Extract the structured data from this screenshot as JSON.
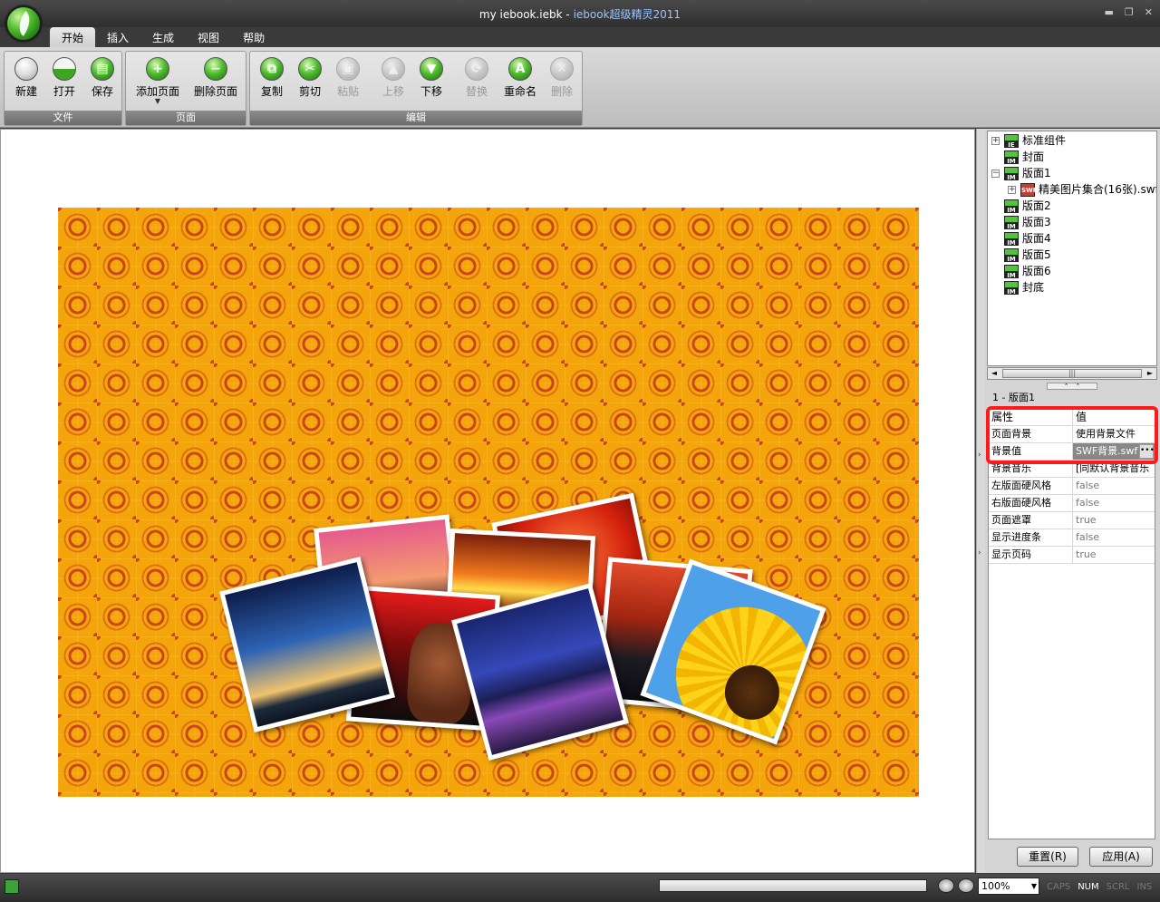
{
  "window": {
    "title_file": "my iebook.iebk - ",
    "title_app": "iebook超级精灵2011"
  },
  "tabs": [
    "开始",
    "插入",
    "生成",
    "视图",
    "帮助"
  ],
  "ribbon": {
    "file_group": {
      "label": "文件",
      "new": "新建",
      "open": "打开",
      "save": "保存"
    },
    "page_group": {
      "label": "页面",
      "add": "添加页面",
      "delete": "删除页面"
    },
    "edit_group": {
      "label": "编辑",
      "copy": "复制",
      "cut": "剪切",
      "paste": "粘贴",
      "up": "上移",
      "down": "下移",
      "replace": "替换",
      "rename": "重命名",
      "remove": "删除"
    }
  },
  "tree": {
    "items": [
      "标准组件",
      "封面",
      "版面1",
      "精美图片集合(16张).swf",
      "版面2",
      "版面3",
      "版面4",
      "版面5",
      "版面6",
      "封底"
    ]
  },
  "panel": {
    "caption": "1 - 版面1",
    "reset": "重置(R)",
    "apply": "应用(A)"
  },
  "props": {
    "head_key": "属性",
    "head_val": "值",
    "rows": [
      {
        "k": "页面背景",
        "v": "使用背景文件"
      },
      {
        "k": "背景值",
        "v": "SWF背景.swf"
      },
      {
        "k": "背景音乐",
        "v": "[同默认背景音乐"
      },
      {
        "k": "左版面硬风格",
        "v": "false"
      },
      {
        "k": "右版面硬风格",
        "v": "false"
      },
      {
        "k": "页面遮罩",
        "v": "true"
      },
      {
        "k": "显示进度条",
        "v": "false"
      },
      {
        "k": "显示页码",
        "v": "true"
      }
    ]
  },
  "status": {
    "zoom": "100%",
    "caps": "CAPS",
    "num": "NUM",
    "scrl": "SCRL",
    "ins": "INS"
  },
  "colors": {
    "page_background": "#f5a50c",
    "highlight_box": "#ff1a1a",
    "accent_title": "#9cc6ff"
  }
}
